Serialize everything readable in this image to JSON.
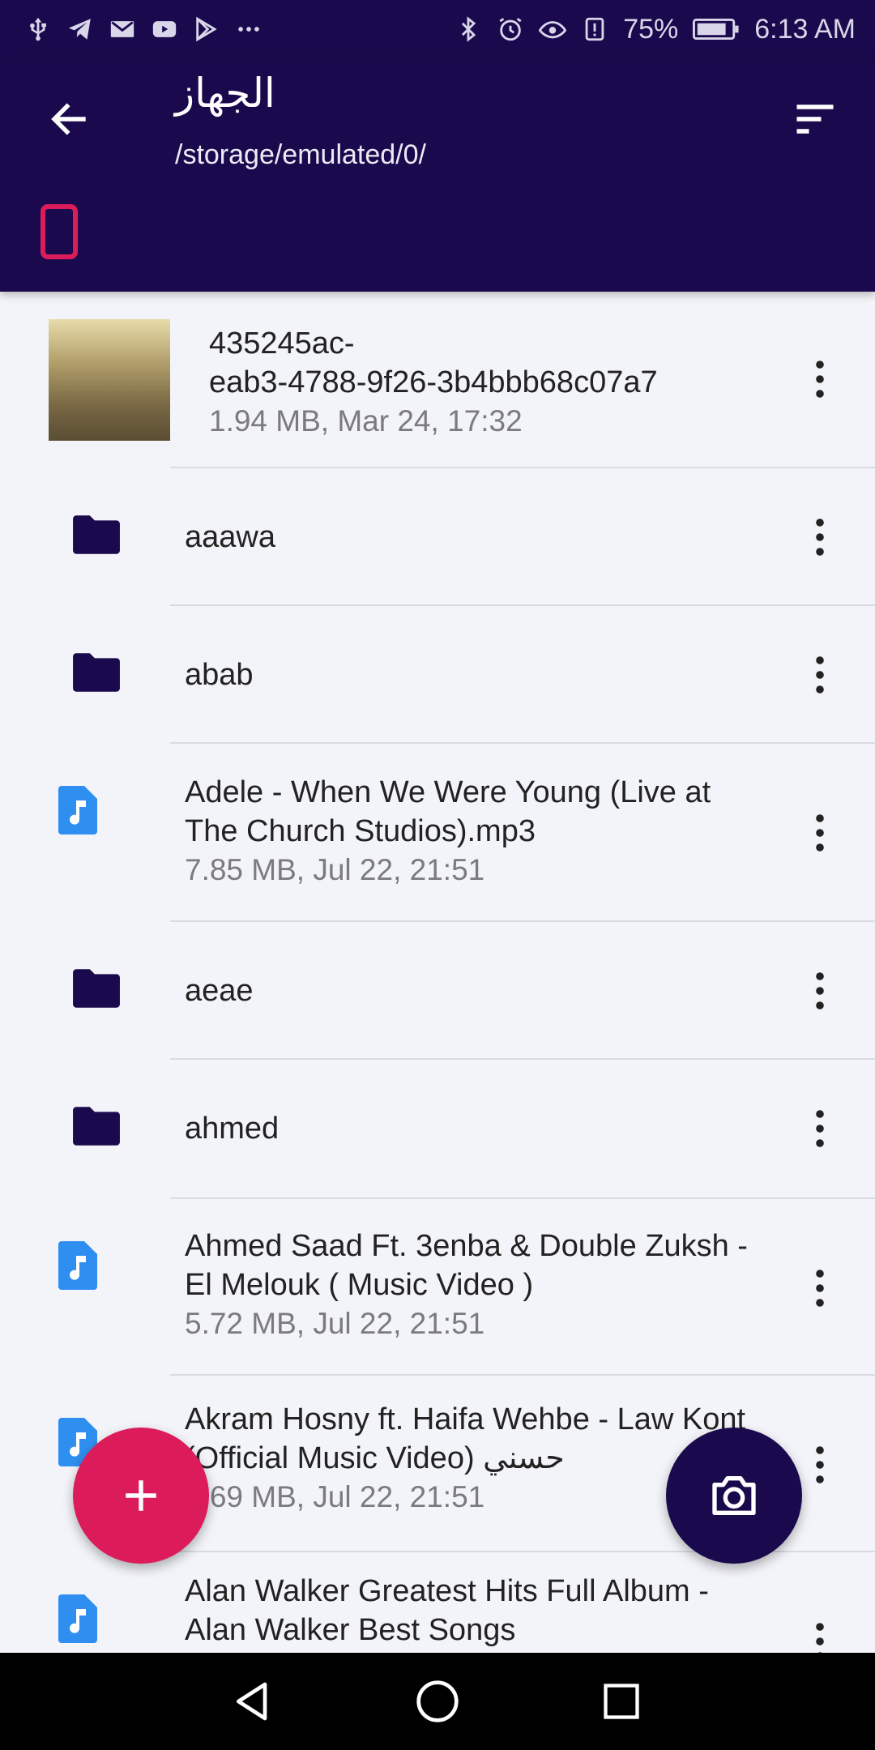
{
  "status_bar": {
    "battery": "75%",
    "time": "6:13 AM",
    "left_icons": [
      "usb-icon",
      "telegram-icon",
      "mail-icon",
      "youtube-icon",
      "play-store-icon",
      "more-icon"
    ],
    "right_icons": [
      "bluetooth-icon",
      "alarm-icon",
      "eye-icon",
      "battery-alert-icon",
      "battery-icon"
    ]
  },
  "app_bar": {
    "title": "الجهاز",
    "path": "/storage/emulated/0/"
  },
  "files": [
    {
      "type": "image",
      "name": "435245ac-\neab3-4788-9f26-3b4bbb68c07a7",
      "meta": "1.94 MB, Mar 24, 17:32"
    },
    {
      "type": "folder",
      "name": "aaawa",
      "meta": ""
    },
    {
      "type": "folder",
      "name": "abab",
      "meta": ""
    },
    {
      "type": "audio",
      "name": "Adele - When We Were Young (Live at The Church Studios).mp3",
      "meta": "7.85 MB, Jul 22, 21:51"
    },
    {
      "type": "folder",
      "name": "aeae",
      "meta": ""
    },
    {
      "type": "folder",
      "name": "ahmed",
      "meta": ""
    },
    {
      "type": "audio",
      "name": "Ahmed Saad Ft. 3enba & Double Zuksh - El Melouk ( Music Video )",
      "meta": "5.72 MB, Jul 22, 21:51"
    },
    {
      "type": "audio",
      "name": "Akram Hosny ft. Haifa Wehbe - Law Kont (Official Music Video) حسني",
      "meta": "5.69 MB, Jul 22, 21:51"
    },
    {
      "type": "audio",
      "name": "Alan Walker Greatest Hits Full Album - Alan Walker Best Songs",
      "meta": ""
    }
  ],
  "colors": {
    "primary": "#1a0a4d",
    "accent": "#dc1c5a",
    "audio_icon": "#2f8ff0",
    "background": "#f3f4f9"
  }
}
